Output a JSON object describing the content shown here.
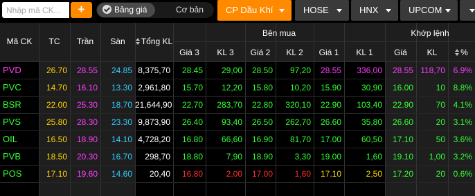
{
  "toolbar": {
    "search_placeholder": "Nhập mã CK...",
    "add_label": "+",
    "toggle_on_label": "Bảng giá",
    "toggle_off_label": "Cơ bản",
    "tabs": [
      {
        "label": "CP Dầu Khí",
        "active": true
      },
      {
        "label": "HOSE"
      },
      {
        "label": "HNX"
      },
      {
        "label": "UPCOM"
      }
    ]
  },
  "table": {
    "group_headers": {
      "buy": "Bên mua",
      "match": "Khớp lệnh"
    },
    "columns": {
      "symbol": "Mã CK",
      "ref": "TC",
      "ceil": "Trần",
      "floor": "Sàn",
      "total": "Tổng KL",
      "p3": "Giá 3",
      "v3": "KL 3",
      "p2": "Giá 2",
      "v2": "KL 2",
      "p1": "Giá 1",
      "v1": "KL 1",
      "mp": "Giá",
      "mv": "KL",
      "pct": "%"
    },
    "rows": [
      {
        "sym": "PVD",
        "tc": "26.70",
        "tran": "28.55",
        "san": "24.85",
        "tong": "8,375,70",
        "g3": "28.45",
        "kl3": "29,00",
        "g2": "28.50",
        "kl2": "97,20",
        "g1": "28.55",
        "kl1": "336,00",
        "gia": "28.55",
        "kl": "118,70",
        "pct": "6.9%",
        "sym_color": "#ff3cff",
        "g3c": "#33ff33",
        "g2c": "#33ff33",
        "g1c": "#ff3cff",
        "mc": "#ff3cff"
      },
      {
        "sym": "PVC",
        "tc": "14.70",
        "tran": "16.10",
        "san": "13.30",
        "tong": "2,961,80",
        "g3": "15.70",
        "kl3": "12,20",
        "g2": "15.80",
        "kl2": "10,20",
        "g1": "15.90",
        "kl1": "30,90",
        "gia": "16.00",
        "kl": "10",
        "pct": "8.8%",
        "sym_color": "#33ff33",
        "g3c": "#33ff33",
        "g2c": "#33ff33",
        "g1c": "#33ff33",
        "mc": "#33ff33"
      },
      {
        "sym": "BSR",
        "tc": "22.00",
        "tran": "25.30",
        "san": "18.70",
        "tong": "21,644,90",
        "g3": "22.70",
        "kl3": "283,70",
        "g2": "22.80",
        "kl2": "320,10",
        "g1": "22.90",
        "kl1": "103,40",
        "gia": "22.90",
        "kl": "70",
        "pct": "4.1%",
        "sym_color": "#33ff33",
        "g3c": "#33ff33",
        "g2c": "#33ff33",
        "g1c": "#33ff33",
        "mc": "#33ff33"
      },
      {
        "sym": "PVS",
        "tc": "25.80",
        "tran": "28.30",
        "san": "23.30",
        "tong": "9,873,90",
        "g3": "26.40",
        "kl3": "93,40",
        "g2": "26.50",
        "kl2": "262,70",
        "g1": "26.60",
        "kl1": "35,80",
        "gia": "26.60",
        "kl": "20",
        "pct": "3.1%",
        "sym_color": "#33ff33",
        "g3c": "#33ff33",
        "g2c": "#33ff33",
        "g1c": "#33ff33",
        "mc": "#33ff33"
      },
      {
        "sym": "OIL",
        "tc": "16.50",
        "tran": "18.90",
        "san": "14.10",
        "tong": "4,728,20",
        "g3": "16.80",
        "kl3": "66,60",
        "g2": "16.90",
        "kl2": "81,70",
        "g1": "17.00",
        "kl1": "60,50",
        "gia": "17.10",
        "kl": "50",
        "pct": "3.6%",
        "sym_color": "#33ff33",
        "g3c": "#33ff33",
        "g2c": "#33ff33",
        "g1c": "#33ff33",
        "mc": "#33ff33"
      },
      {
        "sym": "PVB",
        "tc": "18.50",
        "tran": "20.30",
        "san": "16.70",
        "tong": "298,70",
        "g3": "18.80",
        "kl3": "7,90",
        "g2": "18.90",
        "kl2": "3,30",
        "g1": "19.00",
        "kl1": "1,60",
        "gia": "19.10",
        "kl": "1,00",
        "pct": "3.2%",
        "sym_color": "#33ff33",
        "g3c": "#33ff33",
        "g2c": "#33ff33",
        "g1c": "#33ff33",
        "mc": "#33ff33"
      },
      {
        "sym": "POS",
        "tc": "17.10",
        "tran": "19.60",
        "san": "14.60",
        "tong": "20,40",
        "g3": "16.80",
        "kl3": "2,00",
        "g2": "17.00",
        "kl2": "1,60",
        "g1": "17.10",
        "kl1": "2,50",
        "gia": "17.20",
        "kl": "20",
        "pct": "0.6%",
        "sym_color": "#33ff33",
        "g3c": "#ff2a2a",
        "g2c": "#ff2a2a",
        "g1c": "#ffd700",
        "mc": "#33ff33"
      }
    ]
  },
  "colors": {
    "ref": "#ffd700",
    "ceil": "#ff3cff",
    "floor": "#33ccff",
    "accent": "#ff8a00"
  }
}
